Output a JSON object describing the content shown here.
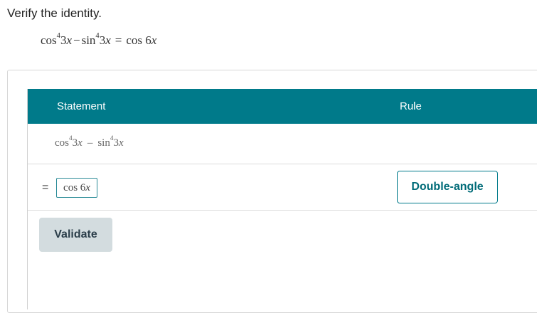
{
  "prompt": "Verify the identity.",
  "identity": {
    "lhs_a_fn": "cos",
    "lhs_a_pow": "4",
    "lhs_a_arg_num": "3",
    "lhs_a_arg_var": "x",
    "minus": "−",
    "lhs_b_fn": "sin",
    "lhs_b_pow": "4",
    "lhs_b_arg_num": "3",
    "lhs_b_arg_var": "x",
    "equals": "=",
    "rhs_fn": "cos",
    "rhs_arg_num": "6",
    "rhs_arg_var": "x"
  },
  "table": {
    "header": {
      "statement": "Statement",
      "rule": "Rule"
    },
    "row1": {
      "a_fn": "cos",
      "a_pow": "4",
      "a_num": "3",
      "a_var": "x",
      "op": "–",
      "b_fn": "sin",
      "b_pow": "4",
      "b_num": "3",
      "b_var": "x"
    },
    "row2": {
      "equals": "=",
      "answer_fn": "cos",
      "answer_num": "6",
      "answer_var": "x",
      "rule_label": "Double-angle"
    }
  },
  "validate_label": "Validate",
  "colors": {
    "header_bg": "#007a8a",
    "accent": "#006b78",
    "validate_bg": "#d3dcdf"
  }
}
